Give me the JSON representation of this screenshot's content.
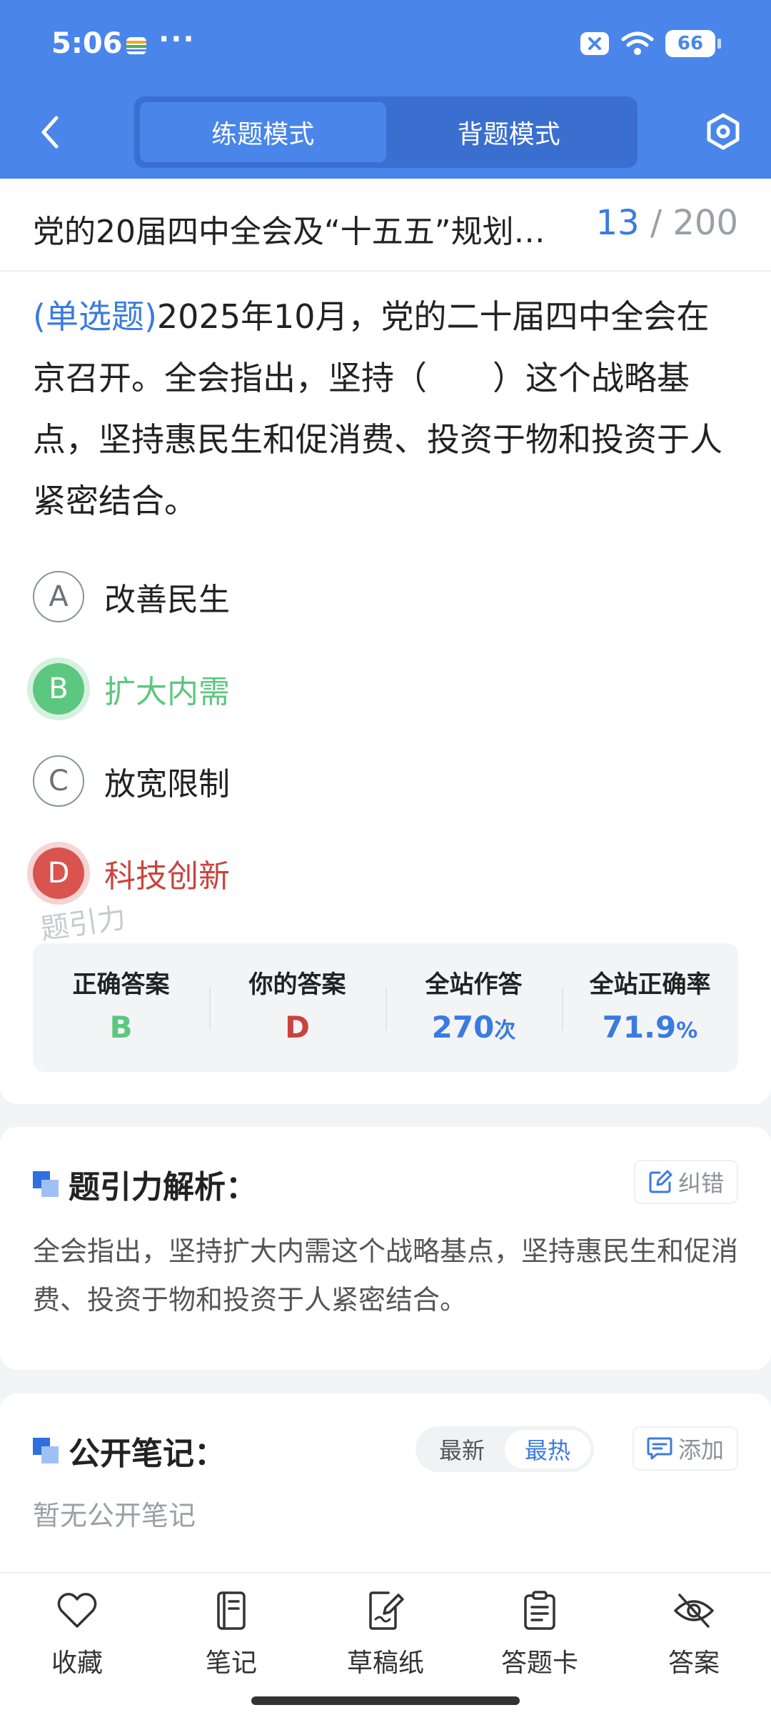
{
  "status_bar": {
    "time": "5:06",
    "dots": "···",
    "battery": "66"
  },
  "nav": {
    "tabs": [
      {
        "label": "练题模式",
        "active": true
      },
      {
        "label": "背题模式",
        "active": false
      }
    ]
  },
  "question_set": {
    "title": "党的20届四中全会及“十五五”规划…",
    "current": "13",
    "total": "/ 200"
  },
  "question": {
    "type": "(单选题)",
    "text": "2025年10月，党的二十届四中全会在京召开。全会指出，坚持（　　）这个战略基点，坚持惠民生和促消费、投资于物和投资于人紧密结合。"
  },
  "options": [
    {
      "letter": "A",
      "text": "改善民生",
      "state": "normal"
    },
    {
      "letter": "B",
      "text": "扩大内需",
      "state": "correct"
    },
    {
      "letter": "C",
      "text": "放宽限制",
      "state": "normal"
    },
    {
      "letter": "D",
      "text": "科技创新",
      "state": "wrong"
    }
  ],
  "watermark": "题引力",
  "stats": {
    "correct_label": "正确答案",
    "correct_value": "B",
    "yours_label": "你的答案",
    "yours_value": "D",
    "count_label": "全站作答",
    "count_value": "270",
    "count_unit": "次",
    "rate_label": "全站正确率",
    "rate_value": "71.9",
    "rate_unit": "%"
  },
  "analysis": {
    "title": "题引力解析：",
    "report_label": "纠错",
    "text": "全会指出，坚持扩大内需这个战略基点，坚持惠民生和促消费、投资于物和投资于人紧密结合。"
  },
  "notes": {
    "title": "公开笔记：",
    "sort_latest": "最新",
    "sort_hot": "最热",
    "add_label": "添加",
    "empty_text": "暂无公开笔记"
  },
  "bottom_bar": [
    {
      "label": "收藏",
      "icon": "heart-icon"
    },
    {
      "label": "笔记",
      "icon": "notebook-icon"
    },
    {
      "label": "草稿纸",
      "icon": "draft-icon"
    },
    {
      "label": "答题卡",
      "icon": "answer-sheet-icon"
    },
    {
      "label": "答案",
      "icon": "eye-off-icon"
    }
  ],
  "colors": {
    "brand": "#4a86ea",
    "correct": "#5cc77e",
    "wrong": "#c9443f",
    "accent": "#3a7be0"
  }
}
